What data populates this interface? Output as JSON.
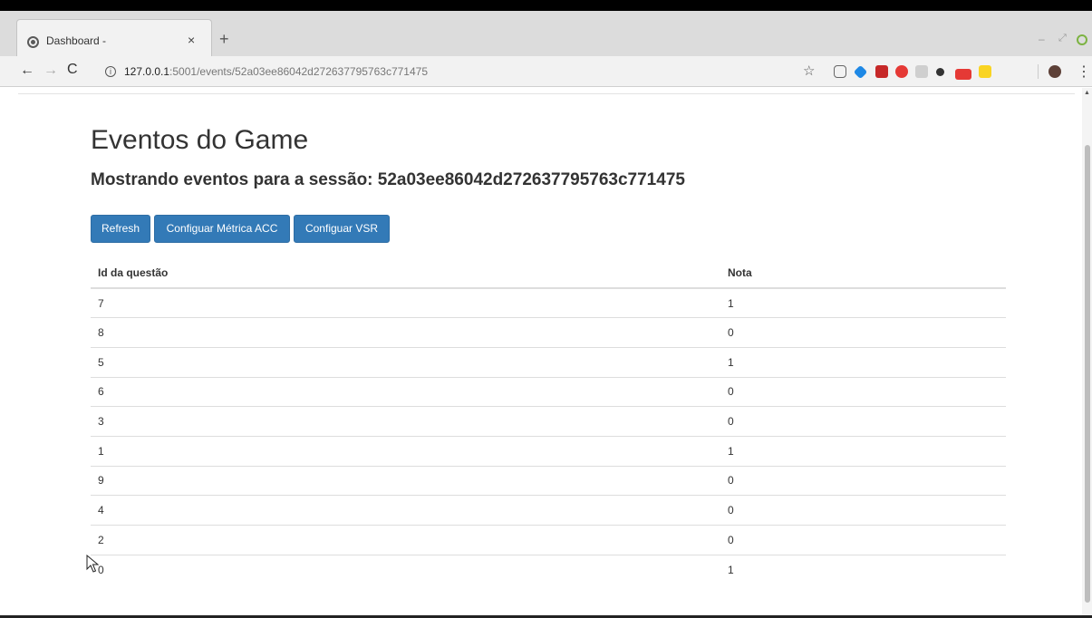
{
  "browser": {
    "tab_title": "Dashboard -",
    "tab_close": "×",
    "new_tab": "+",
    "url_host": "127.0.0.1",
    "url_rest": ":5001/events/52a03ee86042d272637795763c771475"
  },
  "page": {
    "title": "Eventos do Game",
    "subtitle": "Mostrando eventos para a sessão: 52a03ee86042d272637795763c771475",
    "buttons": {
      "refresh": "Refresh",
      "acc": "Configuar Métrica ACC",
      "vsr": "Configuar VSR"
    },
    "table": {
      "headers": [
        "Id da questão",
        "Nota"
      ],
      "rows": [
        [
          "7",
          "1"
        ],
        [
          "8",
          "0"
        ],
        [
          "5",
          "1"
        ],
        [
          "6",
          "0"
        ],
        [
          "3",
          "0"
        ],
        [
          "1",
          "1"
        ],
        [
          "9",
          "0"
        ],
        [
          "4",
          "0"
        ],
        [
          "2",
          "0"
        ],
        [
          "0",
          "1"
        ]
      ]
    }
  },
  "colors": {
    "primary_button": "#337ab7",
    "text": "#333333"
  }
}
